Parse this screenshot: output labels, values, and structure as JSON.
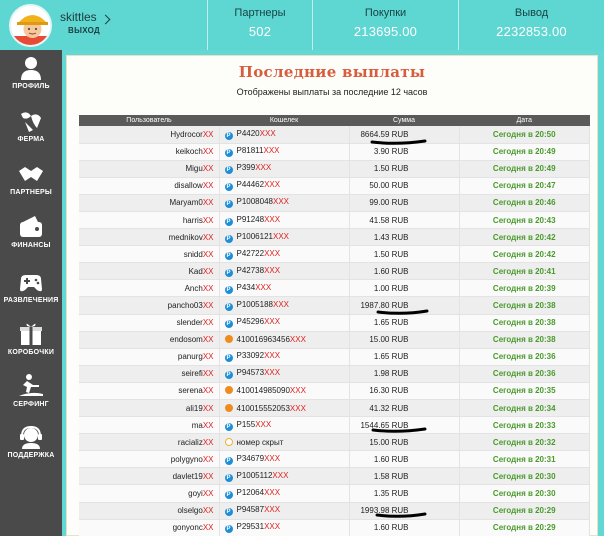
{
  "user": {
    "name": "skittles",
    "logout_label": "ВЫХОД"
  },
  "stats": [
    {
      "label": "Партнеры",
      "value": "502"
    },
    {
      "label": "Покупки",
      "value": "213695.00"
    },
    {
      "label": "Вывод",
      "value": "2232853.00"
    }
  ],
  "nav": [
    {
      "label": "ПРОФИЛЬ",
      "icon": "person-icon"
    },
    {
      "label": "ФЕРМА",
      "icon": "farm-icon"
    },
    {
      "label": "ПАРТНЕРЫ",
      "icon": "handshake-icon"
    },
    {
      "label": "ФИНАНСЫ",
      "icon": "wallet-icon"
    },
    {
      "label": "РАЗВЛЕЧЕНИЯ",
      "icon": "gamepad-icon"
    },
    {
      "label": "КОРОБОЧКИ",
      "icon": "gift-box-icon"
    },
    {
      "label": "СЕРФИНГ",
      "icon": "surfing-icon"
    },
    {
      "label": "ПОДДЕРЖКА",
      "icon": "support-icon"
    }
  ],
  "panel": {
    "title": "Последние выплаты",
    "subtitle": "Отображены выплаты за последние 12 часов"
  },
  "table": {
    "columns": [
      "Пользователь",
      "Кошелек",
      "Сумма",
      "Дата"
    ],
    "rows": [
      {
        "user": "Hydrocor",
        "wallet": "P4420",
        "wtype": "payeer",
        "sum": "8664.59 RUB",
        "date": "Сегодня в 20:50"
      },
      {
        "user": "keikoch",
        "wallet": "P81811",
        "wtype": "payeer",
        "sum": "3.90 RUB",
        "date": "Сегодня в 20:49"
      },
      {
        "user": "Migu",
        "wallet": "P399",
        "wtype": "payeer",
        "sum": "1.50 RUB",
        "date": "Сегодня в 20:49"
      },
      {
        "user": "disallow",
        "wallet": "P44462",
        "wtype": "payeer",
        "sum": "50.00 RUB",
        "date": "Сегодня в 20:47"
      },
      {
        "user": "Maryam0",
        "wallet": "P1008048",
        "wtype": "payeer",
        "sum": "99.00 RUB",
        "date": "Сегодня в 20:46"
      },
      {
        "user": "harris",
        "wallet": "P91248",
        "wtype": "payeer",
        "sum": "41.58 RUB",
        "date": "Сегодня в 20:43"
      },
      {
        "user": "mednikov",
        "wallet": "P1006121",
        "wtype": "payeer",
        "sum": "1.43 RUB",
        "date": "Сегодня в 20:42"
      },
      {
        "user": "snidd",
        "wallet": "P42722",
        "wtype": "payeer",
        "sum": "1.50 RUB",
        "date": "Сегодня в 20:42"
      },
      {
        "user": "Kad",
        "wallet": "P42738",
        "wtype": "payeer",
        "sum": "1.60 RUB",
        "date": "Сегодня в 20:41"
      },
      {
        "user": "Anch",
        "wallet": "P434",
        "wtype": "payeer",
        "sum": "1.00 RUB",
        "date": "Сегодня в 20:39"
      },
      {
        "user": "pancho03",
        "wallet": "P1005188",
        "wtype": "payeer",
        "sum": "1987.80 RUB",
        "date": "Сегодня в 20:38"
      },
      {
        "user": "slender",
        "wallet": "P45296",
        "wtype": "payeer",
        "sum": "1.65 RUB",
        "date": "Сегодня в 20:38"
      },
      {
        "user": "endosom",
        "wallet": "410016963456",
        "wtype": "yandex",
        "sum": "15.00 RUB",
        "date": "Сегодня в 20:38"
      },
      {
        "user": "panurg",
        "wallet": "P33092",
        "wtype": "payeer",
        "sum": "1.65 RUB",
        "date": "Сегодня в 20:36"
      },
      {
        "user": "seirefi",
        "wallet": "P94573",
        "wtype": "payeer",
        "sum": "1.98 RUB",
        "date": "Сегодня в 20:36"
      },
      {
        "user": "serena",
        "wallet": "410014985090",
        "wtype": "yandex",
        "sum": "16.30 RUB",
        "date": "Сегодня в 20:35"
      },
      {
        "user": "ali19",
        "wallet": "410015552053",
        "wtype": "yandex",
        "sum": "41.32 RUB",
        "date": "Сегодня в 20:34"
      },
      {
        "user": "ma",
        "wallet": "P155",
        "wtype": "payeer",
        "sum": "1544.65 RUB",
        "date": "Сегодня в 20:33"
      },
      {
        "user": "racializ",
        "wallet": "номер скрыт",
        "wtype": "hidden",
        "sum": "15.00 RUB",
        "date": "Сегодня в 20:32"
      },
      {
        "user": "polygyno",
        "wallet": "P34679",
        "wtype": "payeer",
        "sum": "1.60 RUB",
        "date": "Сегодня в 20:31"
      },
      {
        "user": "davlet19",
        "wallet": "P1005112",
        "wtype": "payeer",
        "sum": "1.58 RUB",
        "date": "Сегодня в 20:30"
      },
      {
        "user": "goyi",
        "wallet": "P12064",
        "wtype": "payeer",
        "sum": "1.35 RUB",
        "date": "Сегодня в 20:30"
      },
      {
        "user": "olselgo",
        "wallet": "P94587",
        "wtype": "payeer",
        "sum": "1993.98 RUB",
        "date": "Сегодня в 20:29"
      },
      {
        "user": "gonyonc",
        "wallet": "P29531",
        "wtype": "payeer",
        "sum": "1.60 RUB",
        "date": "Сегодня в 20:29"
      }
    ]
  },
  "colors": {
    "topbar": "#5ed6d2",
    "sidebar": "#4a4a4a",
    "title": "#d75d3c",
    "date": "#4a9a2c",
    "masked": "#e02020"
  }
}
